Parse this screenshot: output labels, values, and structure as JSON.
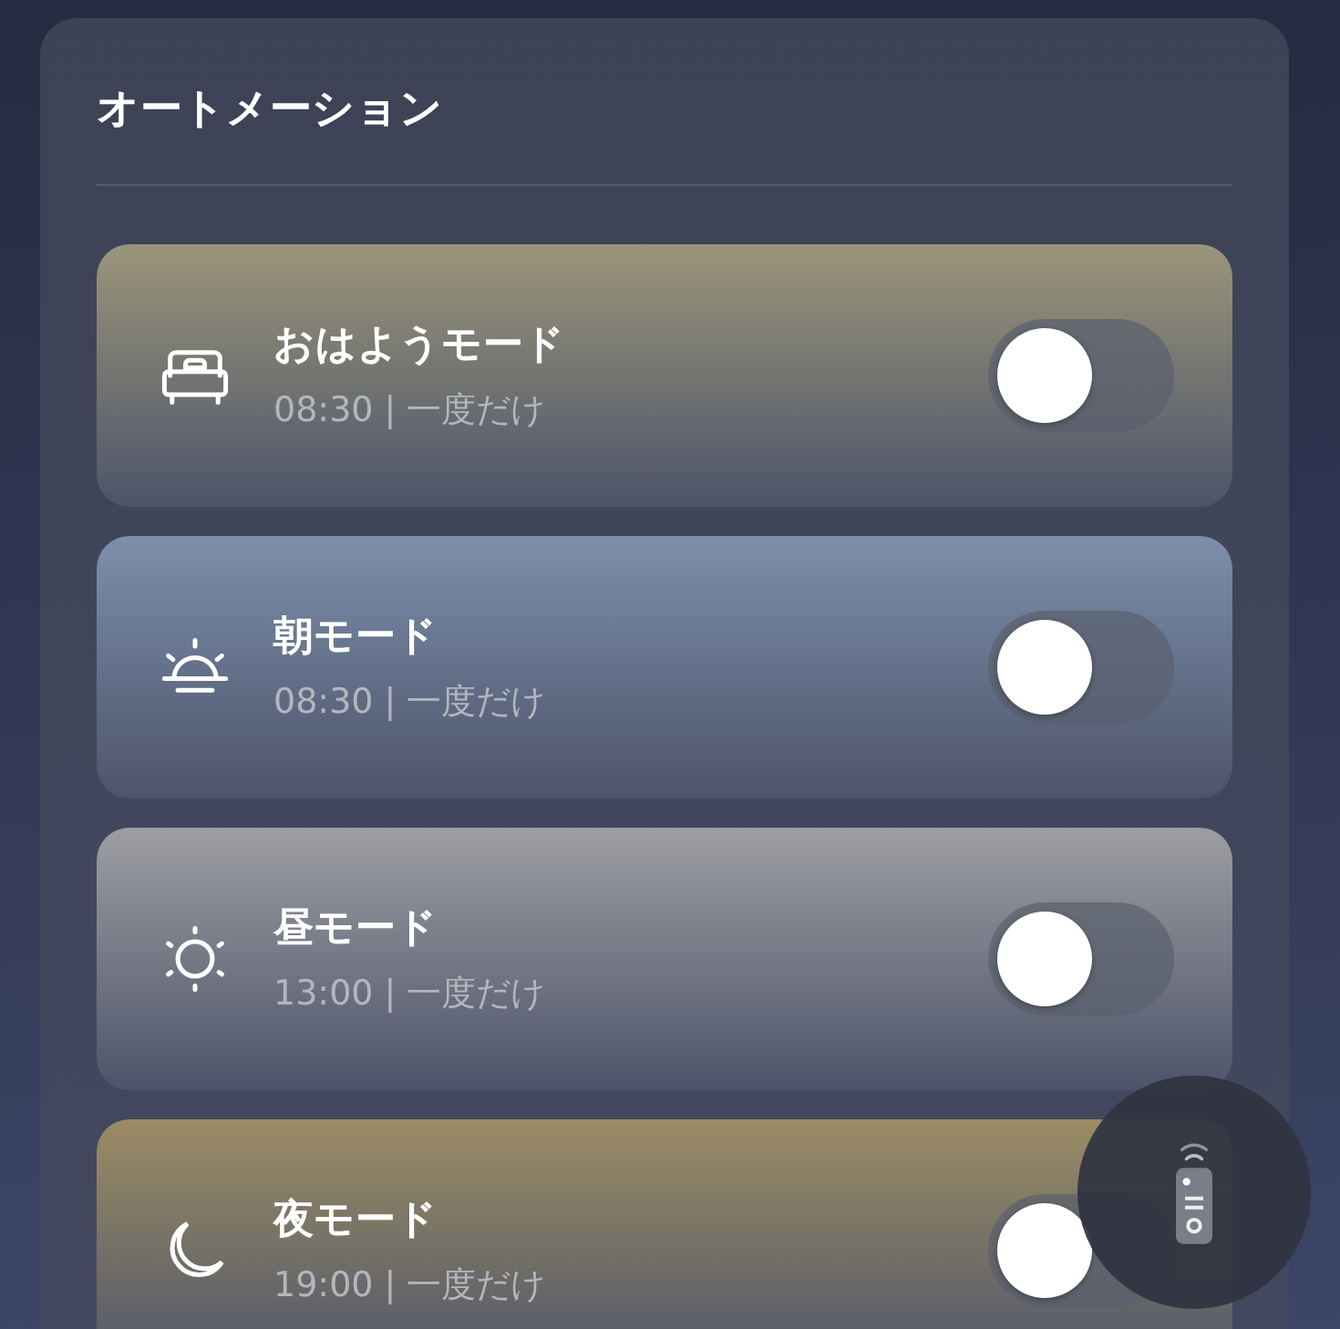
{
  "panel": {
    "title": "オートメーション"
  },
  "automations": [
    {
      "kind": "bed",
      "name": "おはようモード",
      "schedule": "08:30 | 一度だけ",
      "color": "#9a957a",
      "on": false
    },
    {
      "kind": "sunrise",
      "name": "朝モード",
      "schedule": "08:30 | 一度だけ",
      "color": "#7c8fab",
      "on": false
    },
    {
      "kind": "sun",
      "name": "昼モード",
      "schedule": "13:00 | 一度だけ",
      "color": "#9d9ea2",
      "on": false
    },
    {
      "kind": "moon",
      "name": "夜モード",
      "schedule": "19:00 | 一度だけ",
      "color": "#9b8c64",
      "on": false
    }
  ]
}
